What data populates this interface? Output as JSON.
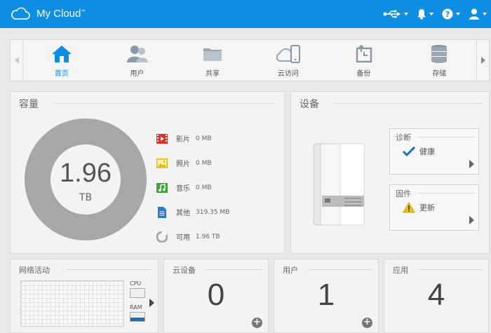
{
  "header": {
    "brand": "My Cloud",
    "trademark": "™",
    "icons": [
      "usb-icon",
      "bell-icon",
      "help-icon",
      "user-icon"
    ]
  },
  "nav": {
    "items": [
      {
        "label": "首页",
        "icon": "home-icon",
        "active": true
      },
      {
        "label": "用户",
        "icon": "users-icon"
      },
      {
        "label": "共享",
        "icon": "folder-icon"
      },
      {
        "label": "云访问",
        "icon": "cloud-access-icon"
      },
      {
        "label": "备份",
        "icon": "backup-icon"
      },
      {
        "label": "存储",
        "icon": "storage-icon"
      }
    ]
  },
  "capacity": {
    "title": "容量",
    "total_value": "1.96",
    "total_unit": "TB",
    "legend": [
      {
        "name": "影片",
        "value": "0 MB",
        "icon": "video-icon",
        "color": "#d9342b"
      },
      {
        "name": "照片",
        "value": "0 MB",
        "icon": "photo-icon",
        "color": "#e8b800"
      },
      {
        "name": "音乐",
        "value": "0 MB",
        "icon": "music-icon",
        "color": "#3aa63a"
      },
      {
        "name": "其他",
        "value": "319.35 MB",
        "icon": "document-icon",
        "color": "#2a79c8"
      },
      {
        "name": "可用",
        "value": "1.96 TB",
        "icon": "pie-icon",
        "color": "#aaaaaa"
      }
    ]
  },
  "device": {
    "title": "设备",
    "diagnostics": {
      "title": "诊断",
      "status": "健康",
      "icon": "check-icon"
    },
    "firmware": {
      "title": "固件",
      "status": "更新",
      "icon": "warning-icon"
    }
  },
  "network": {
    "title": "网络活动",
    "cpu_label": "CPU",
    "ram_label": "RAM"
  },
  "cards": [
    {
      "title": "云设备",
      "count": "0"
    },
    {
      "title": "用户",
      "count": "1"
    },
    {
      "title": "应用",
      "count": "4"
    }
  ]
}
